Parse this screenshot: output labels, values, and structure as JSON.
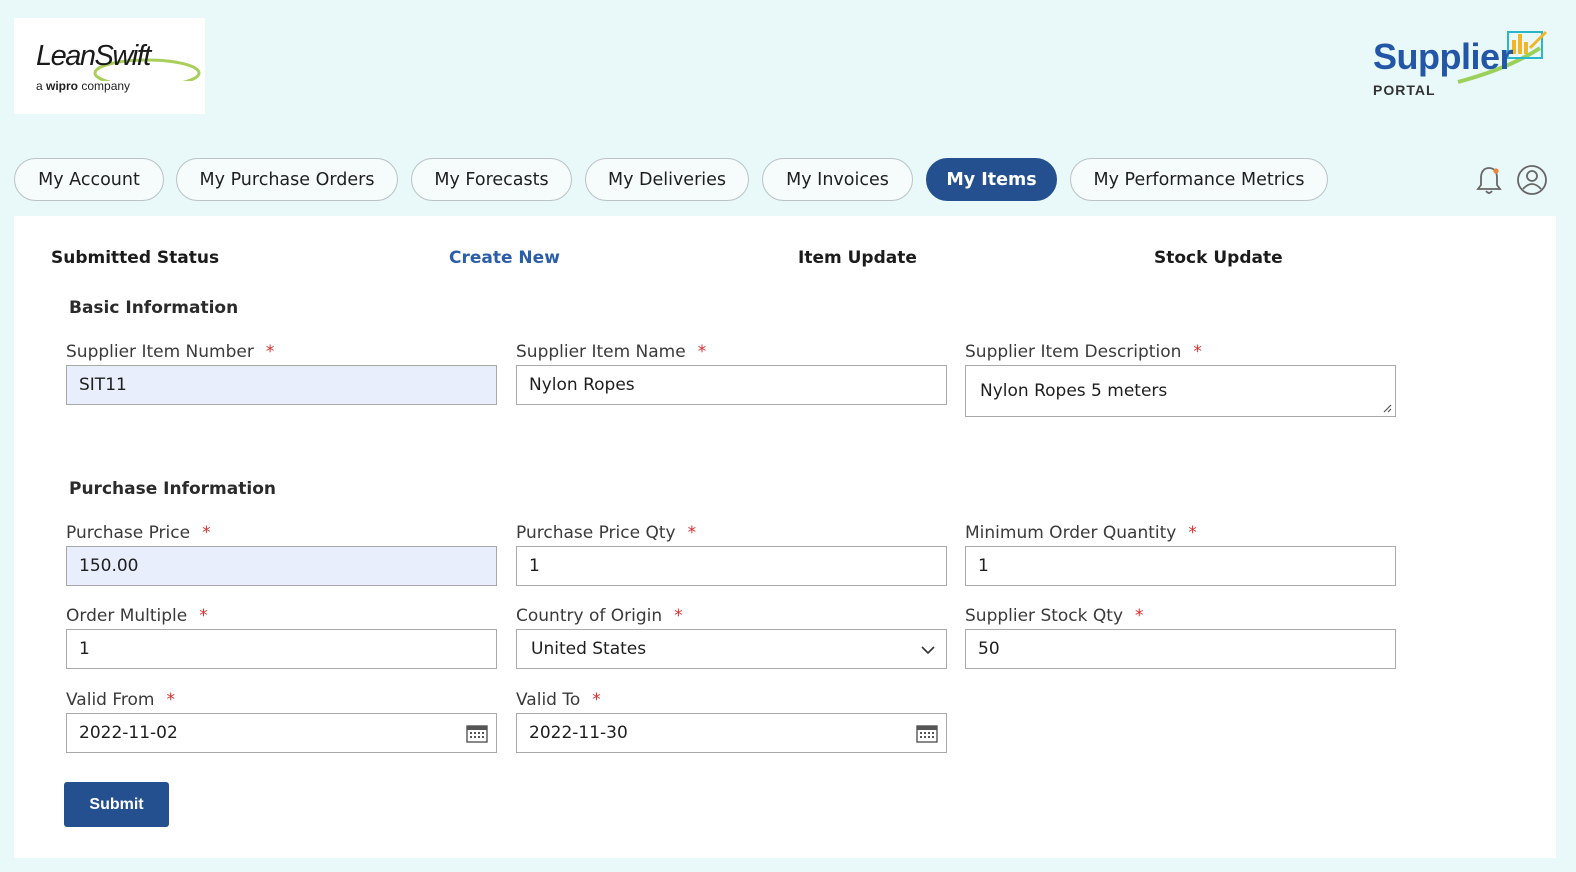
{
  "logo_left": {
    "brand": "LeanSwift",
    "tag_prefix": "a ",
    "tag_bold": "wipro",
    "tag_suffix": " company"
  },
  "logo_right": {
    "word": "Supplier",
    "sub": "PORTAL"
  },
  "nav": [
    {
      "label": "My Account",
      "active": false
    },
    {
      "label": "My Purchase Orders",
      "active": false
    },
    {
      "label": "My Forecasts",
      "active": false
    },
    {
      "label": "My Deliveries",
      "active": false
    },
    {
      "label": "My Invoices",
      "active": false
    },
    {
      "label": "My Items",
      "active": true
    },
    {
      "label": "My Performance Metrics",
      "active": false
    }
  ],
  "icons": {
    "notification": "bell-icon",
    "account": "user-circle-icon"
  },
  "subtabs": {
    "submitted_status": "Submitted Status",
    "create_new": "Create New",
    "item_update": "Item Update",
    "stock_update": "Stock Update"
  },
  "sections": {
    "basic": "Basic Information",
    "purchase": "Purchase Information"
  },
  "required_mark": "*",
  "fields": {
    "item_number": {
      "label": "Supplier Item Number",
      "value": "SIT11"
    },
    "item_name": {
      "label": "Supplier Item Name",
      "value": "Nylon Ropes"
    },
    "item_description": {
      "label": "Supplier Item Description",
      "value": "Nylon Ropes 5 meters"
    },
    "purchase_price": {
      "label": "Purchase Price",
      "value": "150.00"
    },
    "purchase_price_qty": {
      "label": "Purchase Price Qty",
      "value": "1"
    },
    "min_order_qty": {
      "label": "Minimum Order Quantity",
      "value": "1"
    },
    "order_multiple": {
      "label": "Order Multiple",
      "value": "1"
    },
    "country_of_origin": {
      "label": "Country of Origin",
      "value": "United States"
    },
    "supplier_stock_qty": {
      "label": "Supplier Stock Qty",
      "value": "50"
    },
    "valid_from": {
      "label": "Valid From",
      "value": "2022-11-02"
    },
    "valid_to": {
      "label": "Valid To",
      "value": "2022-11-30"
    }
  },
  "submit_label": "Submit",
  "colors": {
    "accent": "#24508f",
    "link": "#2b5ea6",
    "required": "#d92c2c",
    "locked_field": "#e8eefc",
    "background": "#e9f8f8"
  }
}
